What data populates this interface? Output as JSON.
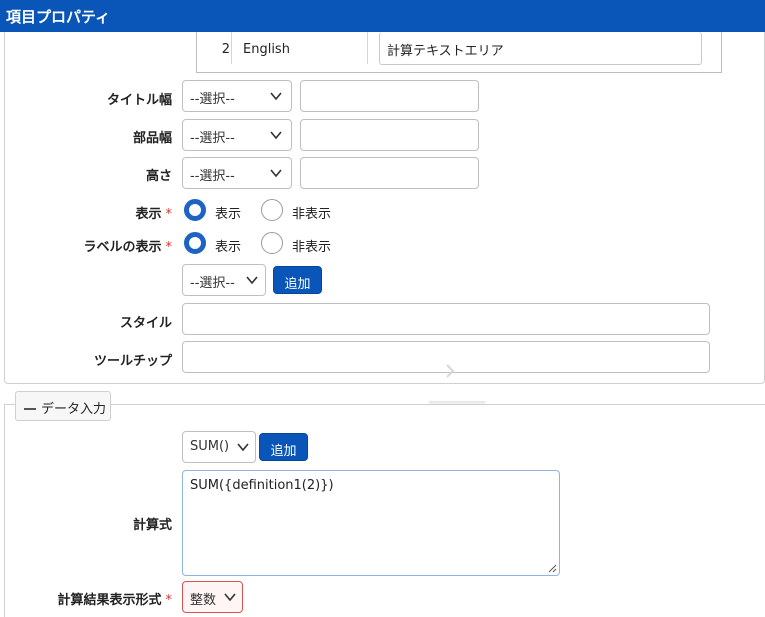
{
  "window": {
    "title": "項目プロパティ"
  },
  "language_rows": [
    {
      "number": "2",
      "language": "English",
      "value": "計算テキストエリア"
    }
  ],
  "form": {
    "title_width": {
      "label": "タイトル幅",
      "select": "--選択--",
      "value": ""
    },
    "part_width": {
      "label": "部品幅",
      "select": "--選択--",
      "value": ""
    },
    "height": {
      "label": "高さ",
      "select": "--選択--",
      "value": ""
    },
    "display": {
      "label": "表示",
      "required_mark": "*",
      "options": [
        "表示",
        "非表示"
      ],
      "selected": "表示"
    },
    "label_display": {
      "label": "ラベルの表示",
      "required_mark": "*",
      "options": [
        "表示",
        "非表示"
      ],
      "selected": "表示"
    },
    "class_select": {
      "select": "--選択--",
      "add_label": "追加"
    },
    "style": {
      "label": "スタイル",
      "value": ""
    },
    "tooltip": {
      "label": "ツールチップ",
      "value": ""
    }
  },
  "data_input": {
    "section_title": "データ入力",
    "function_select": "SUM()",
    "add_label": "追加",
    "formula_label": "計算式",
    "formula_value": "SUM({definition1(2)})",
    "result_format_label": "計算結果表示形式",
    "result_format_required": "*",
    "result_format_value": "整数"
  },
  "colors": {
    "title_bar": "#0a56b8",
    "primary_button": "#0a56b8",
    "radio_selected": "#1e63c4",
    "required": "#d9342b",
    "error_border": "#d9534f"
  }
}
